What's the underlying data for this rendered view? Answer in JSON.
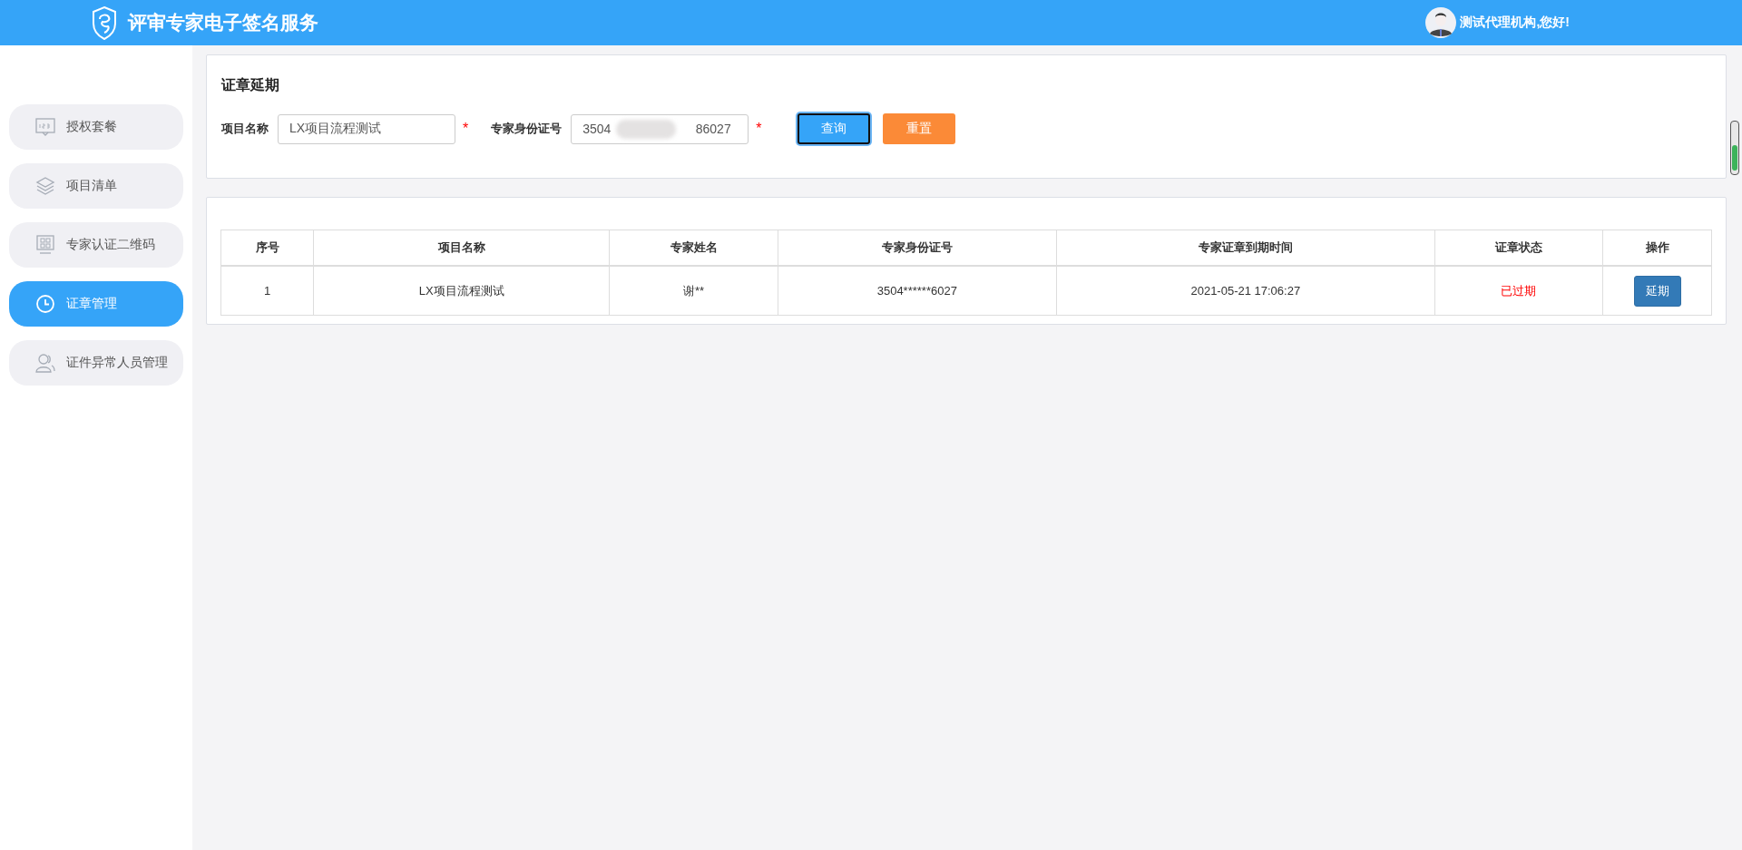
{
  "header": {
    "title": "评审专家电子签名服务",
    "greeting": "测试代理机构,您好!"
  },
  "sidebar": {
    "items": [
      {
        "label": "授权套餐",
        "kind": "counter",
        "selected": false
      },
      {
        "label": "项目清单",
        "kind": "layers",
        "selected": false
      },
      {
        "label": "专家认证二维码",
        "kind": "qrcode",
        "selected": false
      },
      {
        "label": "证章管理",
        "kind": "clock",
        "selected": true
      },
      {
        "label": "证件异常人员管理",
        "kind": "users",
        "selected": false
      }
    ]
  },
  "search_panel": {
    "title": "证章延期",
    "fields": [
      {
        "label": "项目名称",
        "value": "LX项目流程测试",
        "required_mark": "*",
        "kind": "plain"
      },
      {
        "label": "专家身份证号",
        "value": "3504                        86027",
        "required_mark": "*",
        "kind": "redacted"
      }
    ],
    "buttons": [
      {
        "label": "查询",
        "kind": "primary",
        "focused": true
      },
      {
        "label": "重置",
        "kind": "warning",
        "focused": false
      }
    ]
  },
  "table": {
    "columns": [
      "序号",
      "项目名称",
      "专家姓名",
      "专家身份证号",
      "专家证章到期时间",
      "证章状态",
      "操作"
    ],
    "rows": [
      {
        "cells": [
          "1",
          "LX项目流程测试",
          "谢**",
          "3504******6027",
          "2021-05-21 17:06:27"
        ],
        "status": "已过期",
        "kind": "expired",
        "action": "延期"
      }
    ]
  }
}
